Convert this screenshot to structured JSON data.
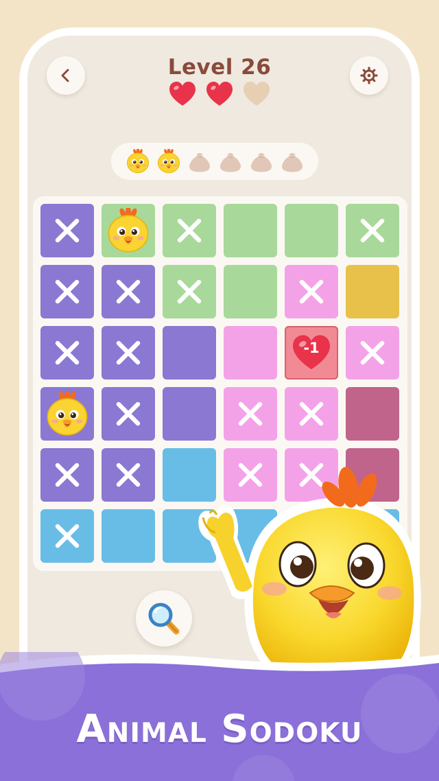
{
  "header": {
    "back_icon": "chevron-left-icon",
    "settings_icon": "gear-icon",
    "level_title": "Level 26",
    "lives": {
      "total": 3,
      "remaining": 2
    }
  },
  "progress": {
    "total_chicks": 6,
    "found_chicks": 2,
    "icon": "chick-icon"
  },
  "grid": {
    "rows": 6,
    "cols": 6,
    "colors": {
      "purple": "#8b78d2",
      "green": "#a8d99a",
      "pink": "#f4a2e8",
      "yellow": "#e7c14a",
      "rose": "#c0648c",
      "blue": "#68bde6",
      "hit": "#f28a96"
    },
    "cells": [
      [
        "purple",
        "green",
        "green",
        "green",
        "green",
        "green"
      ],
      [
        "purple",
        "purple",
        "green",
        "green",
        "pink",
        "yellow"
      ],
      [
        "purple",
        "purple",
        "purple",
        "pink",
        "pink",
        "pink"
      ],
      [
        "purple",
        "purple",
        "purple",
        "pink",
        "pink",
        "rose"
      ],
      [
        "purple",
        "purple",
        "blue",
        "pink",
        "pink",
        "rose"
      ],
      [
        "blue",
        "blue",
        "blue",
        "blue",
        "blue",
        "blue"
      ]
    ],
    "marks": [
      [
        "x",
        "chick",
        "x",
        "",
        "",
        "x"
      ],
      [
        "x",
        "x",
        "x",
        "",
        "x",
        ""
      ],
      [
        "x",
        "x",
        "",
        "",
        "hit",
        "x"
      ],
      [
        "chick",
        "x",
        "",
        "x",
        "x",
        ""
      ],
      [
        "x",
        "x",
        "",
        "x",
        "x",
        ""
      ],
      [
        "x",
        "",
        "",
        "",
        "",
        ""
      ]
    ],
    "penalty_label": "-1"
  },
  "hint_button": {
    "icon": "magnifier-icon"
  },
  "banner": {
    "text": "Animal Sodoku",
    "color": "#8a70d8"
  }
}
